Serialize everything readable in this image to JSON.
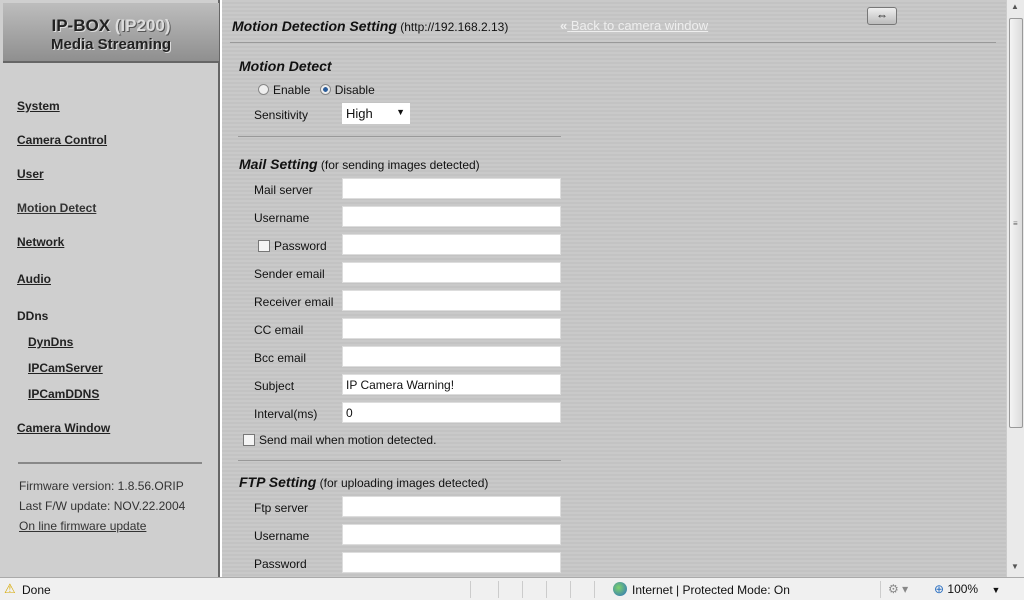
{
  "sidebar": {
    "logo_line1": "IP-BOX",
    "logo_line1b": "(IP200)",
    "logo_line2": "Media Streaming",
    "items": [
      {
        "label": "System"
      },
      {
        "label": "Camera Control"
      },
      {
        "label": "User"
      },
      {
        "label": "Motion Detect"
      },
      {
        "label": "Network"
      },
      {
        "label": "Audio"
      },
      {
        "label": "DDns"
      },
      {
        "label": "DynDns"
      },
      {
        "label": "IPCamServer"
      },
      {
        "label": "IPCamDDNS"
      },
      {
        "label": "Camera Window"
      }
    ],
    "firmware_version": "Firmware version: 1.8.56.ORIP",
    "last_update": "Last F/W update: NOV.22.2004",
    "online_update": "On line firmware update"
  },
  "header": {
    "title": "Motion Detection Setting",
    "url": "(http://192.168.2.13)",
    "back_link": "Back to camera window",
    "back_icon": "double-chevron-left"
  },
  "motion": {
    "title": "Motion Detect",
    "enable": "Enable",
    "disable": "Disable",
    "selected": "Disable",
    "sensitivity_label": "Sensitivity",
    "sensitivity_value": "High"
  },
  "mail": {
    "title": "Mail Setting",
    "subtitle": "(for sending images detected)",
    "fields": [
      {
        "label": "Mail server",
        "value": ""
      },
      {
        "label": "Username",
        "value": ""
      },
      {
        "label": "Password",
        "value": ""
      },
      {
        "label": "Sender email",
        "value": ""
      },
      {
        "label": "Receiver email",
        "value": ""
      },
      {
        "label": "CC email",
        "value": ""
      },
      {
        "label": "Bcc email",
        "value": ""
      },
      {
        "label": "Subject",
        "value": "IP Camera Warning!"
      },
      {
        "label": "Interval(ms)",
        "value": "0"
      }
    ],
    "send_label": "Send mail when motion detected."
  },
  "ftp": {
    "title": "FTP Setting",
    "subtitle": "(for uploading images detected)",
    "fields": [
      {
        "label": "Ftp server",
        "value": ""
      },
      {
        "label": "Username",
        "value": ""
      },
      {
        "label": "Password",
        "value": ""
      }
    ]
  },
  "status": {
    "text": "Done",
    "zone": "Internet | Protected Mode: On",
    "zoom": "100%"
  }
}
